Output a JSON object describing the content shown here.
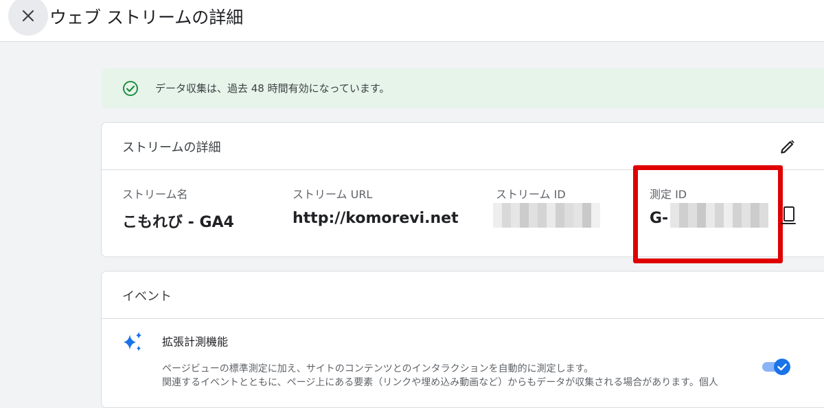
{
  "header": {
    "close_icon": "close-icon",
    "title": "ウェブ ストリームの詳細"
  },
  "banner": {
    "icon": "check-circle-icon",
    "message": "データ収集は、過去 48 時間有効になっています。",
    "color": "#1e8e3e"
  },
  "stream_details": {
    "heading": "ストリームの詳細",
    "edit_icon": "pencil-icon",
    "fields": [
      {
        "label": "ストリーム名",
        "value": "こもれび - GA4"
      },
      {
        "label": "ストリーム URL",
        "value": "http://komorevi.net"
      },
      {
        "label": "ストリーム ID",
        "value": ""
      },
      {
        "label": "測定 ID",
        "value": "G-"
      }
    ],
    "copy_icon": "copy-icon",
    "highlight_color": "#e00000"
  },
  "events": {
    "heading": "イベント",
    "enhanced_measurement": {
      "icon": "sparkle-icon",
      "title": "拡張計測機能",
      "description_line1": "ページビューの標準測定に加え、サイトのコンテンツとのインタラクションを自動的に測定します。",
      "description_line2": "関連するイベントとともに、ページ上にある要素（リンクや埋め込み動画など）からもデータが収集される場合があります。個人",
      "toggle_on": true
    }
  }
}
